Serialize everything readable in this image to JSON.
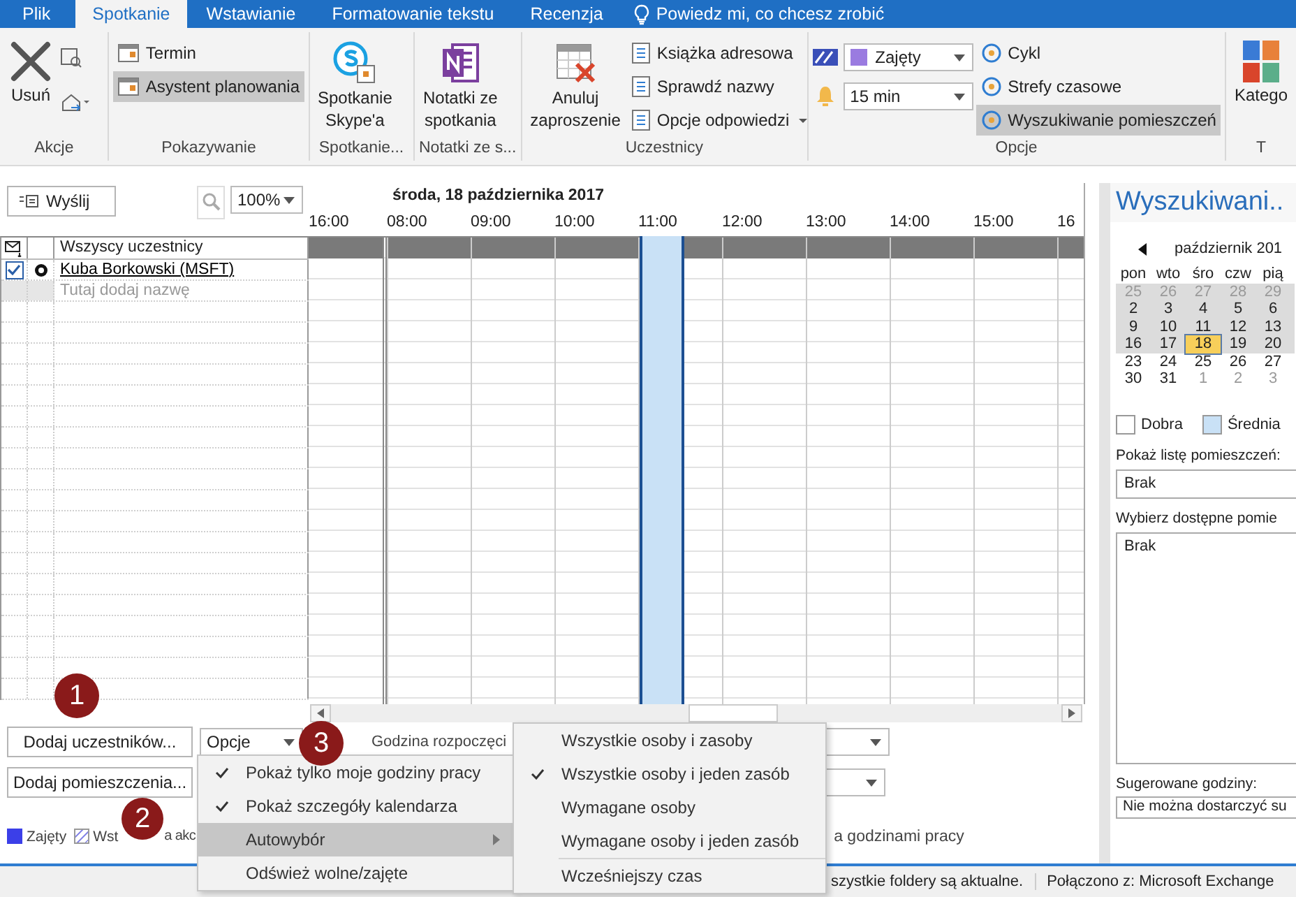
{
  "tabs": [
    {
      "label": "Plik",
      "selected": false
    },
    {
      "label": "Spotkanie",
      "selected": true
    },
    {
      "label": "Wstawianie",
      "selected": false
    },
    {
      "label": "Formatowanie tekstu",
      "selected": false
    },
    {
      "label": "Recenzja",
      "selected": false
    }
  ],
  "tell_me": "Powiedz mi, co chcesz zrobić",
  "ribbon": {
    "actions": {
      "label": "Akcje",
      "delete": "Usuń"
    },
    "show": {
      "label": "Pokazywanie",
      "items": [
        {
          "label": "Termin",
          "selected": false
        },
        {
          "label": "Asystent planowania",
          "selected": true
        }
      ]
    },
    "skype": {
      "label": "Spotkanie...",
      "button": [
        "Spotkanie",
        "Skype'a"
      ]
    },
    "notes": {
      "label": "Notatki ze s...",
      "button": [
        "Notatki ze",
        "spotkania"
      ]
    },
    "attendees": {
      "label": "Uczestnicy",
      "cancel": [
        "Anuluj",
        "zaproszenie"
      ],
      "items": [
        "Książka adresowa",
        "Sprawdź nazwy",
        "Opcje odpowiedzi"
      ]
    },
    "options": {
      "label": "Opcje",
      "show_as": "Zajęty",
      "reminder": "15 min",
      "items": [
        {
          "label": "Cykl",
          "selected": false
        },
        {
          "label": "Strefy czasowe",
          "selected": false
        },
        {
          "label": "Wyszukiwanie pomieszczeń",
          "selected": true
        }
      ]
    },
    "tags": {
      "label": "T",
      "button": "Katego"
    }
  },
  "scheduler": {
    "send": "Wyślij",
    "zoom": "100%",
    "date": "środa, 18 października 2017",
    "times": [
      {
        "label": "16:00",
        "selected": false
      },
      {
        "label": "08:00",
        "selected": false
      },
      {
        "label": "09:00",
        "selected": false
      },
      {
        "label": "10:00",
        "selected": false
      },
      {
        "label": "11:00",
        "selected": true
      },
      {
        "label": "12:00",
        "selected": false
      },
      {
        "label": "13:00",
        "selected": false
      },
      {
        "label": "14:00",
        "selected": false
      },
      {
        "label": "15:00",
        "selected": false
      },
      {
        "label": "16",
        "selected": false
      }
    ],
    "attendee_header": "Wszyscy uczestnicy",
    "attendees": [
      {
        "name": "Kuba Borkowski (MSFT)",
        "checked": true
      }
    ],
    "add_placeholder": "Tutaj dodaj nazwę",
    "add_attendees": "Dodaj uczestników...",
    "options_button": "Opcje",
    "start_label": "Godzina rozpoczęci",
    "add_rooms": "Dodaj pomieszczenia...",
    "legend": [
      {
        "label": "Zajęty",
        "kind": "busy"
      },
      {
        "label": "Wst",
        "kind": "tentative"
      }
    ],
    "legend_covered_rest": "a akc",
    "outside_hours": "a godzinami pracy"
  },
  "options_menu": [
    {
      "label": "Pokaż tylko moje godziny pracy",
      "checked": true,
      "selected": false,
      "submenu": false
    },
    {
      "label": "Pokaż szczegóły kalendarza",
      "checked": true,
      "selected": false,
      "submenu": false
    },
    {
      "label": "Autowybór",
      "checked": false,
      "selected": true,
      "submenu": true
    },
    {
      "label": "Odśwież wolne/zajęte",
      "checked": false,
      "selected": false,
      "submenu": false
    }
  ],
  "autopick_menu": [
    {
      "kind": "item",
      "label": "Wszystkie osoby i zasoby",
      "checked": false
    },
    {
      "kind": "item",
      "label": "Wszystkie osoby i jeden zasób",
      "checked": true
    },
    {
      "kind": "item",
      "label": "Wymagane osoby",
      "checked": false
    },
    {
      "kind": "item",
      "label": "Wymagane osoby i jeden zasób",
      "checked": false
    },
    {
      "kind": "separator"
    },
    {
      "kind": "item",
      "label": "Wcześniejszy czas",
      "checked": false
    }
  ],
  "badges": [
    "1",
    "2",
    "3"
  ],
  "room_finder": {
    "title": "Wyszukiwani..",
    "month": "październik 201",
    "weekdays": [
      "pon",
      "wto",
      "śro",
      "czw",
      "pią"
    ],
    "weeks": [
      {
        "shaded": true,
        "days": [
          {
            "label": "25",
            "other_month": true,
            "selected": false
          },
          {
            "label": "26",
            "other_month": true,
            "selected": false
          },
          {
            "label": "27",
            "other_month": true,
            "selected": false
          },
          {
            "label": "28",
            "other_month": true,
            "selected": false
          },
          {
            "label": "29",
            "other_month": true,
            "selected": false
          }
        ]
      },
      {
        "shaded": true,
        "days": [
          {
            "label": "2",
            "other_month": false,
            "selected": false
          },
          {
            "label": "3",
            "other_month": false,
            "selected": false
          },
          {
            "label": "4",
            "other_month": false,
            "selected": false
          },
          {
            "label": "5",
            "other_month": false,
            "selected": false
          },
          {
            "label": "6",
            "other_month": false,
            "selected": false
          }
        ]
      },
      {
        "shaded": true,
        "days": [
          {
            "label": "9",
            "other_month": false,
            "selected": false
          },
          {
            "label": "10",
            "other_month": false,
            "selected": false
          },
          {
            "label": "11",
            "other_month": false,
            "selected": false
          },
          {
            "label": "12",
            "other_month": false,
            "selected": false
          },
          {
            "label": "13",
            "other_month": false,
            "selected": false
          }
        ]
      },
      {
        "shaded": true,
        "days": [
          {
            "label": "16",
            "other_month": false,
            "selected": false
          },
          {
            "label": "17",
            "other_month": false,
            "selected": false
          },
          {
            "label": "18",
            "other_month": false,
            "selected": true
          },
          {
            "label": "19",
            "other_month": false,
            "selected": false
          },
          {
            "label": "20",
            "other_month": false,
            "selected": false
          }
        ]
      },
      {
        "shaded": false,
        "days": [
          {
            "label": "23",
            "other_month": false,
            "selected": false
          },
          {
            "label": "24",
            "other_month": false,
            "selected": false
          },
          {
            "label": "25",
            "other_month": false,
            "selected": false
          },
          {
            "label": "26",
            "other_month": false,
            "selected": false
          },
          {
            "label": "27",
            "other_month": false,
            "selected": false
          }
        ]
      },
      {
        "shaded": false,
        "days": [
          {
            "label": "30",
            "other_month": false,
            "selected": false
          },
          {
            "label": "31",
            "other_month": false,
            "selected": false
          },
          {
            "label": "1",
            "other_month": true,
            "selected": false
          },
          {
            "label": "2",
            "other_month": true,
            "selected": false
          },
          {
            "label": "3",
            "other_month": true,
            "selected": false
          }
        ]
      }
    ],
    "legend": [
      {
        "label": "Dobra",
        "kind": "good"
      },
      {
        "label": "Średnia",
        "kind": "fair"
      }
    ],
    "room_list_label": "Pokaż listę pomieszczeń:",
    "room_list_value": "Brak",
    "available_label": "Wybierz dostępne pomie",
    "available_items": [
      "Brak"
    ],
    "suggested_label": "Sugerowane godziny:",
    "suggested_text": "Nie można dostarczyć su"
  },
  "status": [
    "szystkie foldery są aktualne.",
    "Połączono z: Microsoft Exchange"
  ]
}
